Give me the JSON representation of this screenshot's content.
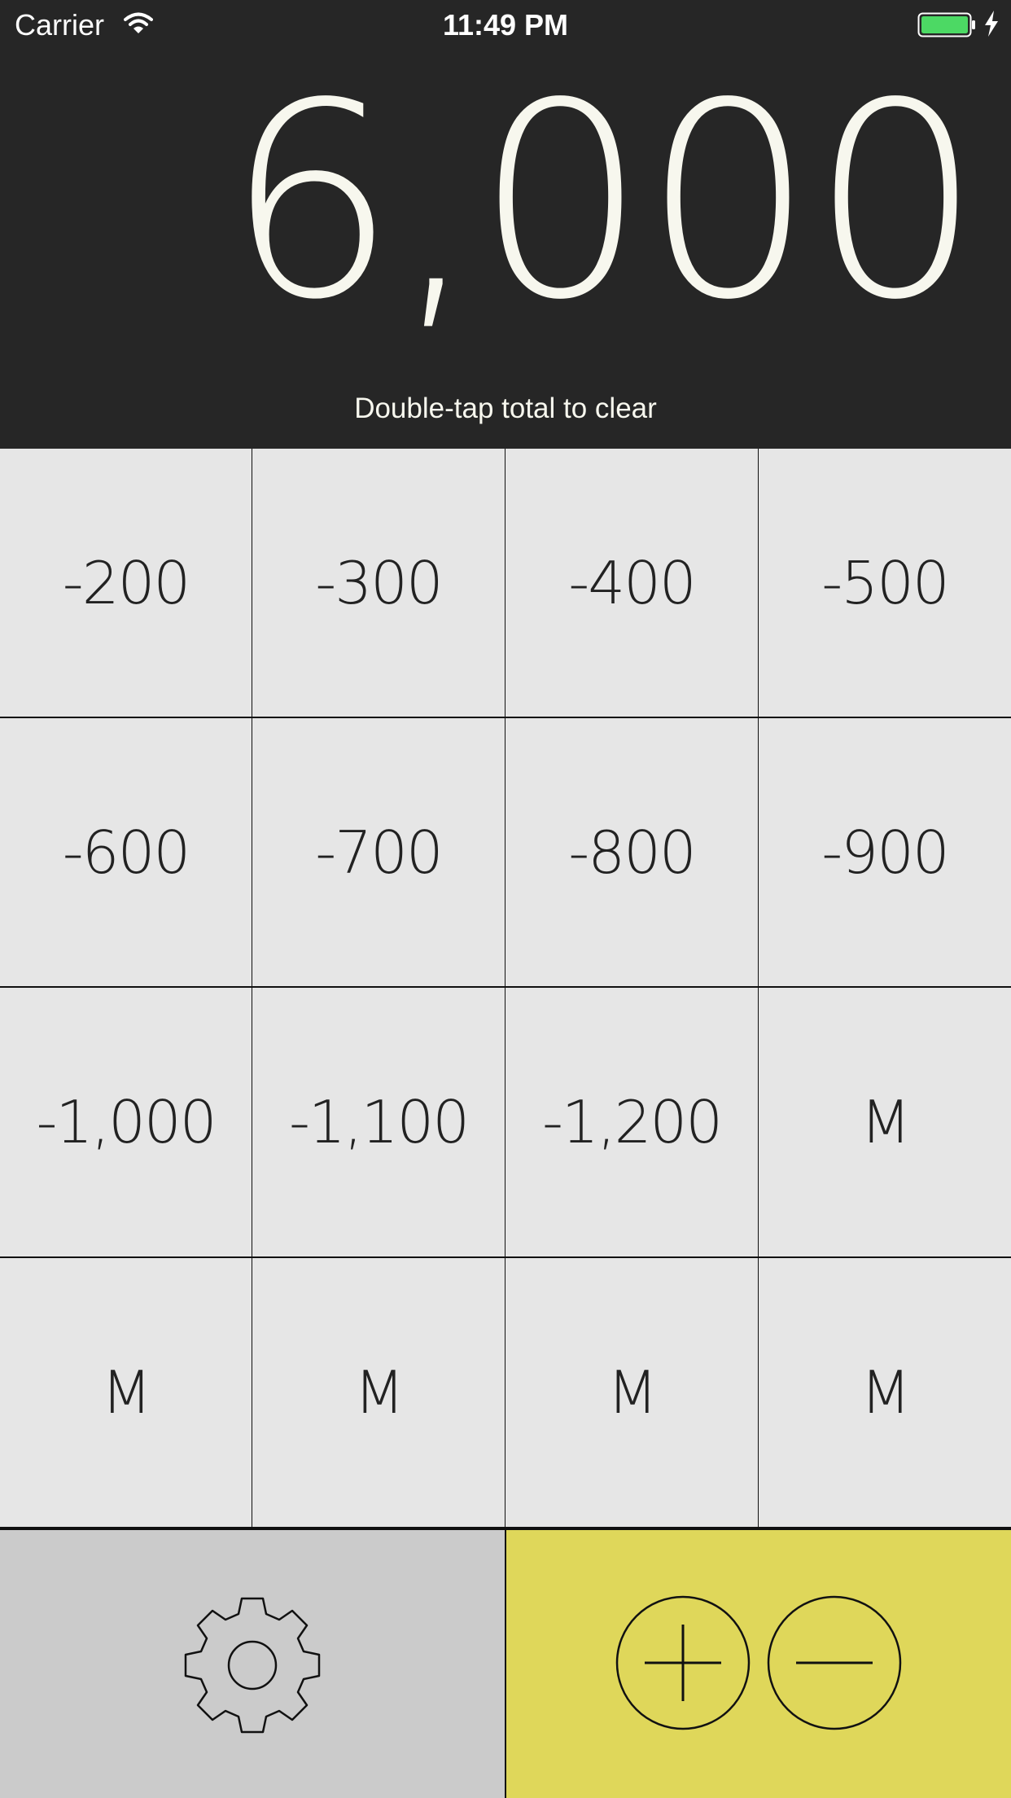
{
  "status_bar": {
    "carrier": "Carrier",
    "time": "11:49 PM",
    "icons": [
      "wifi-icon",
      "battery-icon",
      "charging-icon"
    ]
  },
  "display": {
    "total": "6,000",
    "hint": "Double-tap total to clear"
  },
  "keys": [
    {
      "label": "-200"
    },
    {
      "label": "-300"
    },
    {
      "label": "-400"
    },
    {
      "label": "-500"
    },
    {
      "label": "-600"
    },
    {
      "label": "-700"
    },
    {
      "label": "-800"
    },
    {
      "label": "-900"
    },
    {
      "label": "-1,000"
    },
    {
      "label": "-1,100"
    },
    {
      "label": "-1,200"
    },
    {
      "label": "M"
    },
    {
      "label": "M"
    },
    {
      "label": "M"
    },
    {
      "label": "M"
    },
    {
      "label": "M"
    }
  ],
  "bottom_bar": {
    "settings_icon": "gear-icon",
    "mode_icons": [
      "plus-circle-icon",
      "minus-circle-icon"
    ]
  },
  "colors": {
    "header_background": "#262626",
    "display_text": "#f7f7ee",
    "key_background": "#e6e6e6",
    "settings_background": "#cbcbcb",
    "mode_background": "#dfd75a",
    "battery_fill": "#4cd964"
  }
}
